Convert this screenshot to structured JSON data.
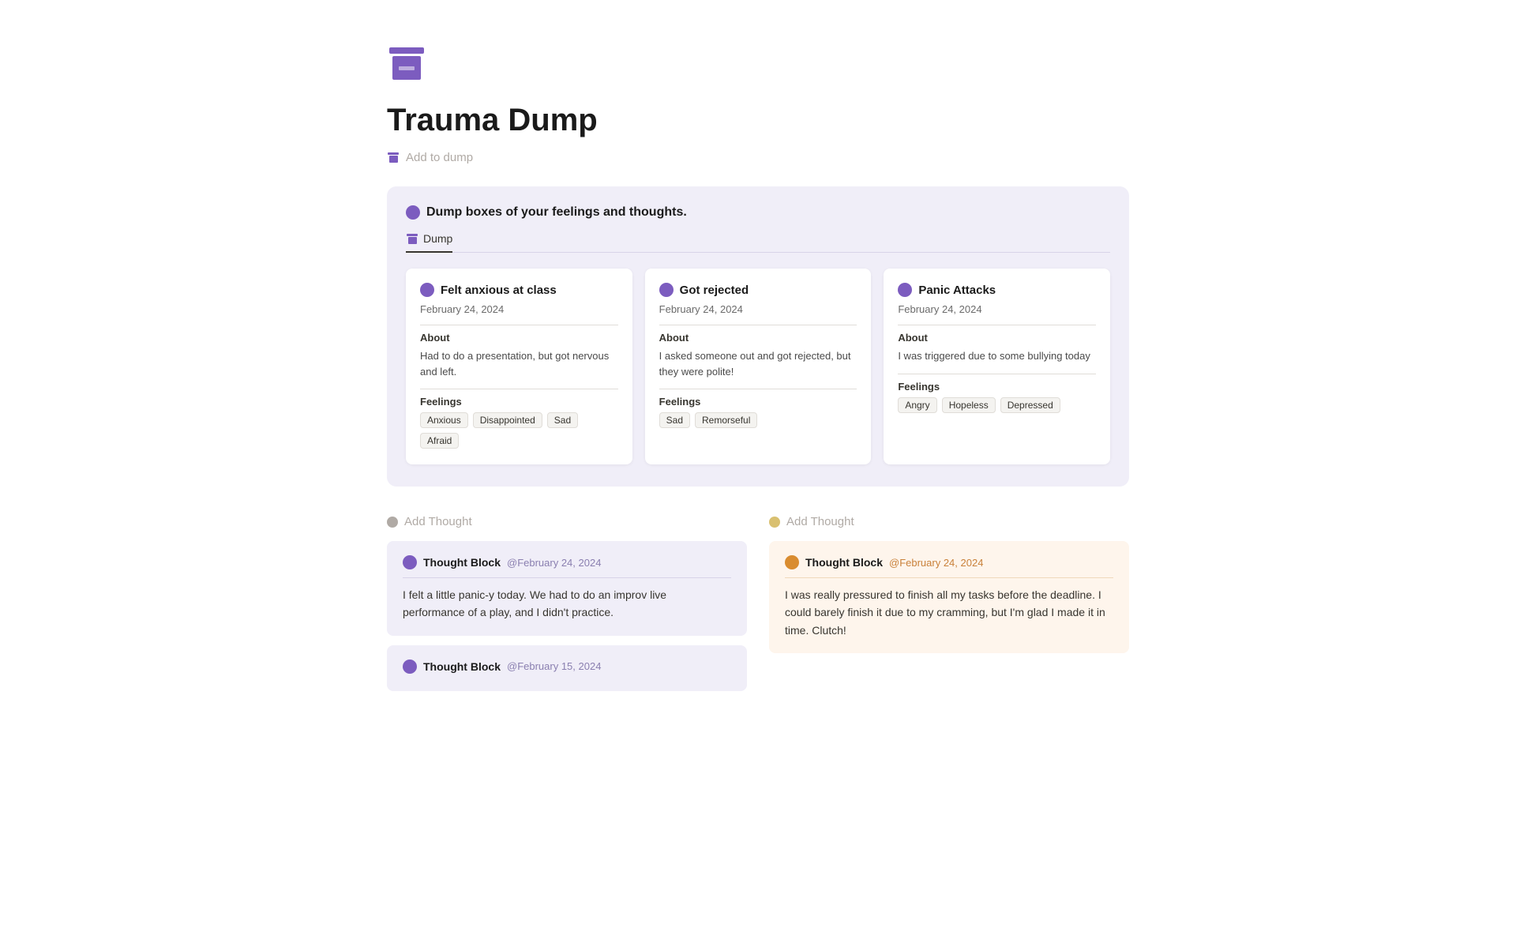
{
  "page": {
    "icon_alt": "archive box icon",
    "title": "Trauma Dump",
    "add_to_dump_label": "Add to dump"
  },
  "dump_section": {
    "header": "Dump boxes of your feelings and thoughts.",
    "tab_label": "Dump",
    "cards": [
      {
        "title": "Felt anxious at class",
        "date": "February 24, 2024",
        "about_label": "About",
        "about_text": "Had to do a presentation, but got nervous and left.",
        "feelings_label": "Feelings",
        "feelings": [
          "Anxious",
          "Disappointed",
          "Sad",
          "Afraid"
        ]
      },
      {
        "title": "Got rejected",
        "date": "February 24, 2024",
        "about_label": "About",
        "about_text": "I asked someone out and got rejected, but they were polite!",
        "feelings_label": "Feelings",
        "feelings": [
          "Sad",
          "Remorseful"
        ]
      },
      {
        "title": "Panic Attacks",
        "date": "February 24, 2024",
        "about_label": "About",
        "about_text": "I was triggered due to some bullying today",
        "feelings_label": "Feelings",
        "feelings": [
          "Angry",
          "Hopeless",
          "Depressed"
        ]
      }
    ]
  },
  "thought_columns": [
    {
      "add_thought_label": "Add Thought",
      "color": "purple",
      "blocks": [
        {
          "title": "Thought Block",
          "date": "@February 24, 2024",
          "text": "I felt a little panic-y today. We had to do an improv live performance of a play, and I didn't practice."
        },
        {
          "title": "Thought Block",
          "date": "@February 15, 2024",
          "text": ""
        }
      ]
    },
    {
      "add_thought_label": "Add Thought",
      "color": "orange",
      "blocks": [
        {
          "title": "Thought Block",
          "date": "@February 24, 2024",
          "text": "I was really pressured to finish all my tasks before the deadline. I could barely finish it due to my cramming, but I'm glad I made it in time. Clutch!"
        }
      ]
    }
  ]
}
